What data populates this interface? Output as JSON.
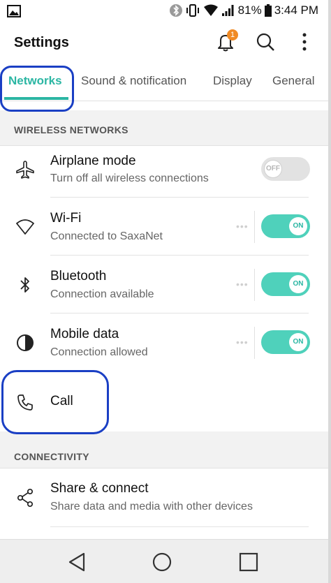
{
  "status_bar": {
    "battery_percent": "81%",
    "time": "3:44 PM"
  },
  "app_bar": {
    "title": "Settings",
    "notification_count": "1"
  },
  "tabs": [
    {
      "label": "Networks",
      "active": true
    },
    {
      "label": "Sound & notification",
      "active": false
    },
    {
      "label": "Display",
      "active": false
    },
    {
      "label": "General",
      "active": false
    }
  ],
  "sections": {
    "wireless": {
      "header": "WIRELESS NETWORKS"
    },
    "connectivity": {
      "header": "CONNECTIVITY"
    }
  },
  "rows": {
    "airplane": {
      "title": "Airplane mode",
      "subtitle": "Turn off all wireless connections",
      "toggle": "OFF"
    },
    "wifi": {
      "title": "Wi-Fi",
      "subtitle": "Connected to SaxaNet",
      "toggle": "ON",
      "more": "•••"
    },
    "bluetooth": {
      "title": "Bluetooth",
      "subtitle": "Connection available",
      "toggle": "ON",
      "more": "•••"
    },
    "mobile_data": {
      "title": "Mobile data",
      "subtitle": "Connection allowed",
      "toggle": "ON",
      "more": "•••"
    },
    "call": {
      "title": "Call"
    },
    "share": {
      "title": "Share & connect",
      "subtitle": "Share data and media with other devices"
    }
  },
  "colors": {
    "accent": "#2bb6a3",
    "toggle_on": "#4fd1bb",
    "badge": "#f08a24",
    "annotation": "#1a3fc4"
  }
}
